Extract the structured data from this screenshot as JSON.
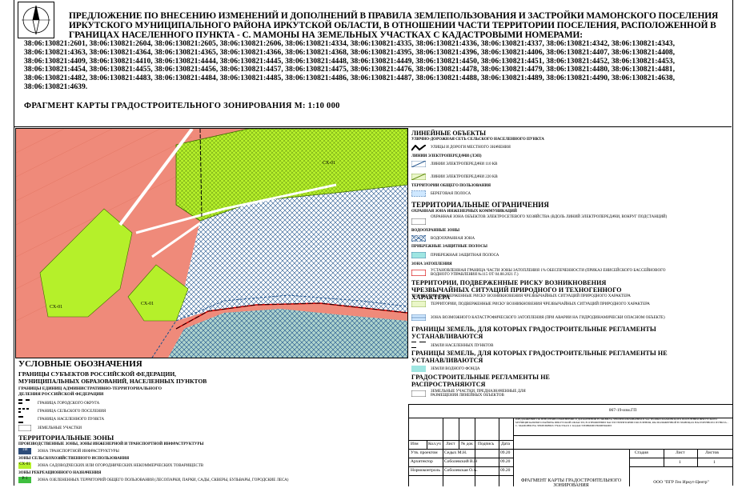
{
  "colors": {
    "residential": "#ef8a7a",
    "green": "#b5f02a",
    "map_bg": "#ffffff",
    "hatch": "#1b4f8a",
    "red_border": "#d40000",
    "water": "#9fe6e2"
  },
  "header": {
    "title": "ПРЕДЛОЖЕНИЕ ПО ВНЕСЕНИЮ ИЗМЕНЕНИЙ И ДОПОЛНЕНИЙ В ПРАВИЛА ЗЕМЛЕПОЛЬЗОВАНИЯ И ЗАСТРОЙКИ МАМОНСКОГО ПОСЕЛЕНИЯ ИРКУТСКОГО МУНИЦИПАЛЬНОГО РАЙОНА ИРКУТСКОЙ ОБЛАСТИ, В ОТНОШЕНИИ ЧАСТИ ТЕРРИТОРИИ ПОСЕЛЕНИЯ, РАСПОЛОЖЕННОЙ В ГРАНИЦАХ НАСЕЛЕННОГО ПУНКТА - С. МАМОНЫ НА ЗЕМЕЛЬНЫХ УЧАСТКАХ С КАДАСТРОВЫМИ НОМЕРАМИ:",
    "cadastral": "38:06:130821:2601, 38:06:130821:2604, 38:06:130821:2605, 38:06:130821:2606, 38:06:130821:4334, 38:06:130821:4335, 38:06:130821:4336, 38:06:130821:4337, 38:06:130821:4342, 38:06:130821:4343, 38:06:130821:4363, 38:06:130821:4364, 38:06:130821:4365, 38:06:130821:4366, 38:06:130821:4368, 38:06:130821:4395, 38:06:130821:4396, 38:06:130821:4406, 38:06:130821:4407, 38:06:130821:4408, 38:06:130821:4409, 38:06:130821:4410, 38:06:130821:4444, 38:06:130821:4445, 38:06:130821:4448, 38:06:130821:4449, 38:06:130821:4450, 38:06:130821:4451, 38:06:130821:4452, 38:06:130821:4453, 38:06:130821:4454, 38:06:130821:4455, 38:06:130821:4456, 38:06:130821:4457, 38:06:130821:4475, 38:06:130821:4476, 38:06:130821:4478, 38:06:130821:4479, 38:06:130821:4480, 38:06:130821:4481, 38:06:130821:4482, 38:06:130821:4483, 38:06:130821:4484, 38:06:130821:4485, 38:06:130821:4486, 38:06:130821:4487, 38:06:130821:4488, 38:06:130821:4489, 38:06:130821:4490, 38:06:130821:4638, 38:06:130821:4639.",
    "fragment": "ФРАГМЕНТ КАРТЫ ГРАДОСТРОИТЕЛЬНОГО ЗОНИРОВАНИЯ  М: 1:10 000"
  },
  "map_labels": {
    "zone1": "СХ-01",
    "zone2": "СХ-01",
    "zone3": "СХ-01"
  },
  "legend_right": {
    "linear_title": "ЛИНЕЙНЫЕ ОБЪЕКТЫ",
    "street_net": "УЛИЧНО-ДОРОЖНАЯ СЕТЬ СЕЛЬСКОГО НАСЕЛЕННОГО ПУНКТА",
    "streets": "УЛИЦЫ И ДОРОГИ МЕСТНОГО ЗНАЧЕНИЯ",
    "power_lines": "ЛИНИИ ЭЛЕКТРОПЕРЕДАЧИ (ЛЭП)",
    "lep110": "ЛИНИИ ЭЛЕКТРОПЕРЕДАЧИ 110 КВ",
    "lep220": "ЛИНИИ ЭЛЕКТРОПЕРЕДАЧИ 220 КВ",
    "common_use": "ТЕРРИТОРИИ ОБЩЕГО ПОЛЬЗОВАНИЯ",
    "shore": "БЕРЕГОВАЯ ПОЛОСА",
    "restrictions": "ТЕРРИТОРИАЛЬНЫЕ ОГРАНИЧЕНИЯ",
    "eng_protection": "ОХРАННАЯ ЗОНА ИНЖЕНЕРНЫХ КОММУНИКАЦИЙ",
    "elec_zone": "ОХРАННАЯ ЗОНА ОБЪЕКТОВ ЭЛЕКТРОСЕТЕВОГО ХОЗЯЙСТВА (ВДОЛЬ ЛИНИЙ ЭЛЕКТРОПЕРЕДАЧИ, ВОКРУГ ПОДСТАНЦИЙ)",
    "water_zones": "ВОДООХРАННЫЕ ЗОНЫ",
    "water_zone": "ВОДООХРАННАЯ ЗОНА",
    "coastal": "ПРИБРЕЖНЫЕ ЗАЩИТНЫЕ ПОЛОСЫ",
    "coastal_strip": "ПРИБРЕЖНАЯ ЗАЩИТНАЯ ПОЛОСА",
    "flood": "ЗОНА ЗАТОПЛЕНИЯ",
    "flood_desc": "УСТАНОВЛЕННАЯ ГРАНИЦА ЧАСТИ ЗОНЫ ЗАТОПЛЕНИЯ 1% ОБЕСПЕЧЕННОСТИ (ПРИКАЗ ЕНИСЕЙСКОГО БАССЕЙНОВОГО ВОДНОГО УПРАВЛЕНИЯ №115 ОТ 04.08.2021 Г.)",
    "risk_title": "ТЕРРИТОРИИ, ПОДВЕРЖЕННЫЕ РИСКУ ВОЗНИКНОВЕНИЯ ЧРЕЗВЫЧАЙНЫХ СИТУАЦИЙ ПРИРОДНОГО И ТЕХНОГЕННОГО ХАРАКТЕРА",
    "risk_sub": "ТЕРРИТОРИИ, ПОДВЕРЖЕННЫЕ РИСКУ ВОЗНИКНОВЕНИЯ ЧРЕЗВЫЧАЙНЫХ СИТУАЦИЙ ПРИРОДНОГО ХАРАКТЕРА",
    "risk_item": "ТЕРРИТОРИИ, ПОДВЕРЖЕННЫЕ РИСКУ ВОЗНИКНОВЕНИЯ ЧРЕЗВЫЧАЙНЫХ СИТУАЦИЙ ПРИРОДНОГО ХАРАКТЕРА",
    "risk_flood": "ЗОНА ВОЗМОЖНОГО КАТАСТРОФИЧЕСКОГО ЗАТОПЛЕНИЯ (ПРИ АВАРИИ НА ГИДРОДИНАМИЧЕСКИ ОПАСНОМ ОБЪЕКТЕ)",
    "bound1": "ГРАНИЦЫ ЗЕМЕЛЬ, ДЛЯ КОТОРЫХ ГРАДОСТРОИТЕЛЬНЫЕ РЕГЛАМЕНТЫ УСТАНАВЛИВАЮТСЯ",
    "bound1_item": "ЗЕМЛИ НАСЕЛЕННЫХ ПУНКТОВ",
    "bound2": "ГРАНИЦЫ ЗЕМЕЛЬ, ДЛЯ КОТОРЫХ ГРАДОСТРОИТЕЛЬНЫЕ РЕГЛАМЕНТЫ НЕ УСТАНАВЛИВАЮТСЯ",
    "bound2_item": "ЗЕМЛИ ВОДНОГО ФОНДА",
    "not_apply": "ГРАДОСТРОИТЕЛЬНЫЕ РЕГЛАМЕНТЫ НЕ РАСПРОСТРАНЯЮТСЯ",
    "not_apply_item": "ЗЕМЕЛЬНЫЕ УЧАСТКИ, ПРЕДНАЗНАЧЕННЫЕ ДЛЯ РАЗМЕЩЕНИЯ ЛИНЕЙНЫХ ОБЪЕКТОВ"
  },
  "legend_left": {
    "title": "УСЛОВНЫЕ ОБОЗНАЧЕНИЯ",
    "bounds": "ГРАНИЦЫ СУБЪЕКТОВ РОССИЙСКОЙ ФЕДЕРАЦИИ, МУНИЦИПАЛЬНЫХ ОБРАЗОВАНИЙ, НАСЕЛЕННЫХ ПУНКТОВ",
    "admin": "ГРАНИЦЫ ЕДИНИЦ АДМИНИСТРАТИВНО-ТЕРРИТОРИАЛЬНОГО ДЕЛЕНИЯ РОССИЙСКОЙ ФЕДЕРАЦИИ",
    "city_district": "ГРАНИЦА ГОРОДСКОГО ОКРУГА",
    "rural": "ГРАНИЦА СЕЛЬСКОГО ПОСЕЛЕНИЯ",
    "settlement": "ГРАНИЦА НАСЕЛЕННОГО ПУНКТА",
    "land": "ЗЕМЕЛЬНЫЕ УЧАСТКИ",
    "zones_title": "ТЕРРИТОРИАЛЬНЫЕ ЗОНЫ",
    "prod_zones": "ПРОИЗВОДСТВЕННЫЕ ЗОНЫ, ЗОНЫ ИНЖЕНЕРНОЙ И ТРАНСПОРТНОЙ ИНФРАСТРУКТУРЫ",
    "tr_code": "ТИ",
    "tr_label": "ЗОНА ТРАНСПОРТНОЙ ИНФРАСТРУКТУРЫ",
    "agri_zones": "ЗОНЫ СЕЛЬСКОХОЗЯЙСТВЕННОГО ИСПОЛЬЗОВАНИЯ",
    "sh_code": "СХ-01",
    "sh_label": "ЗОНА САДОВОДЧЕСКИХ ИЛИ ОГОРОДНИЧЕСКИХ НЕКОММЕРЧЕСКИХ ТОВАРИЩЕСТВ",
    "rec_zones": "ЗОНЫ РЕКРЕАЦИОННОГО НАЗНАЧЕНИЯ",
    "r_code": "Р-1",
    "r_label": "ЗОНА ОЗЕЛЕНЕННЫХ ТЕРРИТОРИЙ ОБЩЕГО ПОЛЬЗОВАНИЯ (ЛЕСОПАРКИ, ПАРКИ, САДЫ, СКВЕРЫ, БУЛЬВАРЫ, ГОРОДСКИЕ ЛЕСА)"
  },
  "stamp": {
    "code": "067-19-изм.ГП",
    "desc": "ПРЕДЛОЖЕНИЕ ПО ВНЕСЕНИЮ ИЗМЕНЕНИЙ И ДОПОЛНЕНИЙ В ПРАВИЛА ЗЕМЛЕПОЛЬЗОВАНИЯ И ЗАСТРОЙКИ МАМОНСКОГО ПОСЕЛЕНИЯ ИРКУТСКОГО МУНИЦИПАЛЬНОГО РАЙОНА ИРКУТСКОЙ ОБЛАСТИ, В ОТНОШЕНИИ ЧАСТИ ТЕРРИТОРИИ ПОСЕЛЕНИЯ, РАСПОЛОЖЕННОЙ В ГРАНИЦАХ НАСЕЛЕННОГО ПУНКТА - С. МАМОНЫ НА ЗЕМЕЛЬНЫХ УЧАСТКАХ С КАДАСТРОВЫМИ НОМЕРАМИ",
    "head_cols": [
      "Изм",
      "Кол.уч",
      "Лист",
      "№ док",
      "Подпись",
      "Дата"
    ],
    "rows": [
      {
        "role": "Утв. проектом",
        "name": "Седых М.Н.",
        "date": "09.20"
      },
      {
        "role": "Архитектор",
        "name": "Соболевский В.Н",
        "date": "09.20"
      },
      {
        "role": "Нормоконтроль",
        "name": "Соболевская О.А.",
        "date": "09.20"
      }
    ],
    "stage_h": "Стадия",
    "sheet_h": "Лист",
    "sheets_h": "Листов",
    "sheet": "1",
    "sheets": "1",
    "title": "ФРАГМЕНТ КАРТЫ ГРАДОСТРОИТЕЛЬНОГО ЗОНИРОВАНИЯ",
    "org": "ООО \"ПГР Гео Иркут-Центр\""
  }
}
